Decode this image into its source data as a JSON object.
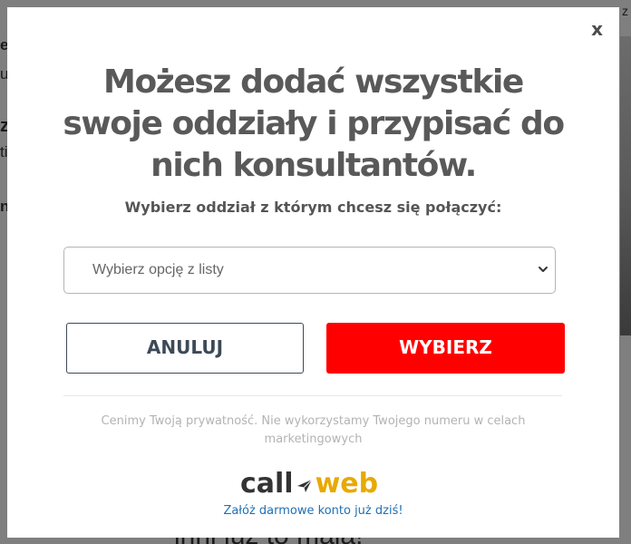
{
  "background": {
    "fragments": [
      "e",
      "u",
      "z",
      "ti",
      "n",
      "z",
      "inni już to mają!"
    ]
  },
  "modal": {
    "close_label": "x",
    "headline": [
      "Możesz dodać wszystkie",
      "swoje oddziały i przypisać do",
      "nich konsultantów."
    ],
    "subtitle": "Wybierz oddział z którym chcesz się połączyć:",
    "select": {
      "selected_text": "Wybierz opcję z listy",
      "icon": "chevron-down-icon"
    },
    "cancel_label": "ANULUJ",
    "confirm_label": "WYBIERZ",
    "privacy_text": "Cenimy Twoją prywatność. Nie wykorzystamy Twojego numeru w celach marketingowych",
    "logo": {
      "part1": "call",
      "part2": "web",
      "icon": "paper-plane-icon"
    },
    "signup_link": "Załóż darmowe konto już dziś!"
  },
  "colors": {
    "confirm": "#ff0000",
    "cancel_border": "#3d4a57",
    "headline": "#595959",
    "logo_accent": "#e8a900",
    "link": "#1f6fb5"
  }
}
